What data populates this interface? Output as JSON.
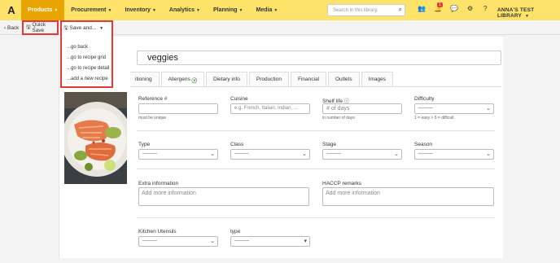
{
  "nav": {
    "logo": "A",
    "items": [
      {
        "label": "Products"
      },
      {
        "label": "Procurement"
      },
      {
        "label": "Inventory"
      },
      {
        "label": "Analytics"
      },
      {
        "label": "Planning"
      },
      {
        "label": "Media"
      }
    ],
    "search_placeholder": "Search in this library.",
    "notification_count": "1",
    "library_name": "ANNA'S TEST LIBRARY"
  },
  "toolbar": {
    "back": "Back",
    "quick_save": "Quick Save",
    "save_and": "Save and..."
  },
  "save_menu": {
    "items": [
      "...go back",
      "...go to recipe grid",
      "...go to recipe detail",
      "...add a new recipe"
    ]
  },
  "recipe": {
    "title_fragment": "veggies"
  },
  "tabs": [
    {
      "label": "itioning"
    },
    {
      "label": "Allergens"
    },
    {
      "label": "Dietary info"
    },
    {
      "label": "Production"
    },
    {
      "label": "Financial"
    },
    {
      "label": "Outlets"
    },
    {
      "label": "Images"
    }
  ],
  "form": {
    "reference": {
      "label": "Reference #",
      "hint": "must be unique"
    },
    "cuisine": {
      "label": "Cuisine",
      "placeholder": "e.g. French, Italian, Indian, ..."
    },
    "shelf_life": {
      "label": "Shelf life",
      "placeholder": "# of days",
      "hint": "in number of days"
    },
    "difficulty": {
      "label": "Difficulty",
      "value": "---------",
      "hint": "1 = easy > 5 = difficult"
    },
    "type": {
      "label": "Type",
      "value": "---------"
    },
    "class": {
      "label": "Class",
      "value": "---------"
    },
    "stage": {
      "label": "Stage",
      "value": "---------"
    },
    "season": {
      "label": "Season",
      "value": "---------"
    },
    "extra_info": {
      "label": "Extra information",
      "placeholder": "Add more information"
    },
    "haccp": {
      "label": "HACCP remarks",
      "placeholder": "Add more information"
    },
    "kitchen_utensils": {
      "label": "Kitchen Utensils",
      "value": "---------"
    },
    "utensil_type": {
      "label": "type",
      "value": "---------"
    }
  },
  "colors": {
    "topbar": "#fde36a",
    "active_nav": "#e8a400",
    "highlight": "#e53935"
  }
}
